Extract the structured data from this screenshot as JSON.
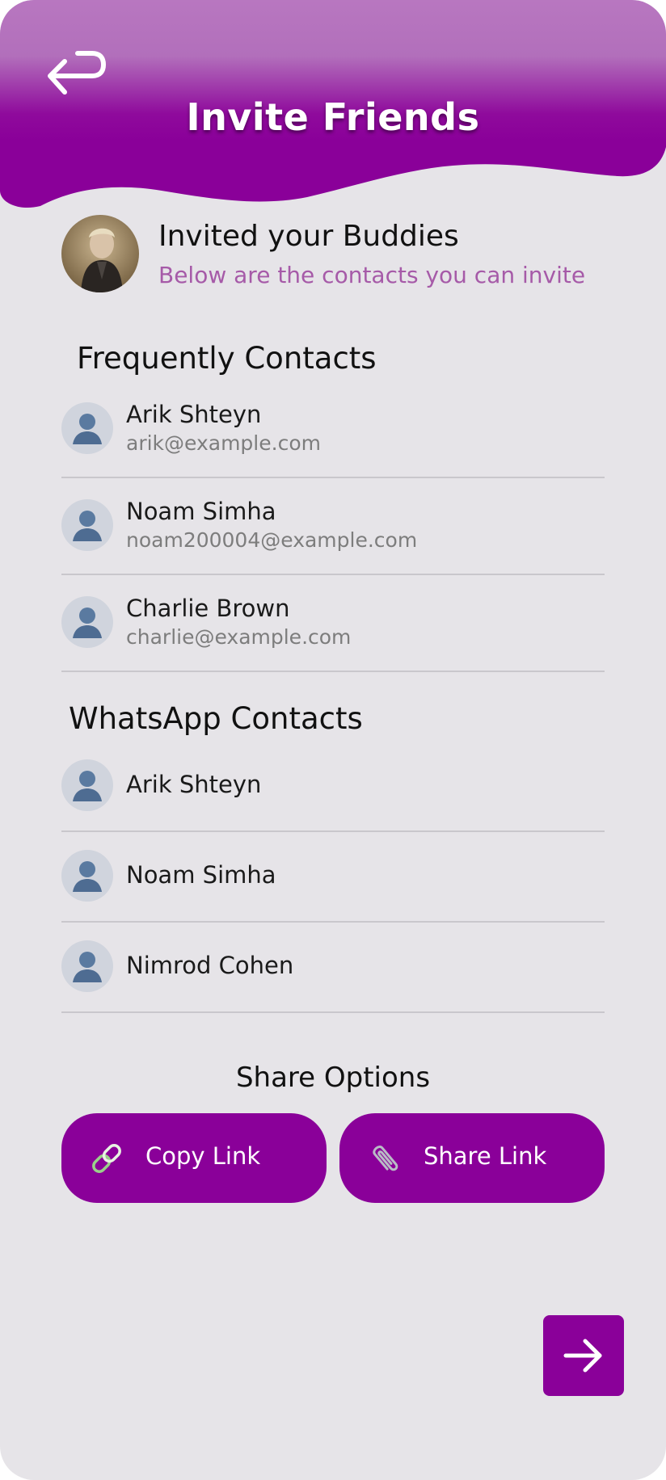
{
  "header": {
    "title": "Invite Friends",
    "back_icon": "return-arrow-icon"
  },
  "intro": {
    "title": "Invited your Buddies",
    "subtitle": "Below are the contacts you can invite"
  },
  "frequent": {
    "title": "Frequently Contacts",
    "items": [
      {
        "name": "Arik Shteyn",
        "email": "arik@example.com"
      },
      {
        "name": "Noam Simha",
        "email": "noam200004@example.com"
      },
      {
        "name": "Charlie Brown",
        "email": "charlie@example.com"
      }
    ]
  },
  "whatsapp": {
    "title": "WhatsApp Contacts",
    "items": [
      {
        "name": "Arik Shteyn"
      },
      {
        "name": "Noam Simha"
      },
      {
        "name": "Nimrod Cohen"
      }
    ]
  },
  "share": {
    "title": "Share Options",
    "copy_label": "Copy Link",
    "copy_icon": "link-icon",
    "share_label": "Share Link",
    "share_icon": "paperclip-icon"
  },
  "next_icon": "arrow-right-icon",
  "colors": {
    "primary": "#8a0099",
    "header_light": "#b877c0",
    "background": "#e6e4e8",
    "subtitle": "#a65aa8"
  }
}
